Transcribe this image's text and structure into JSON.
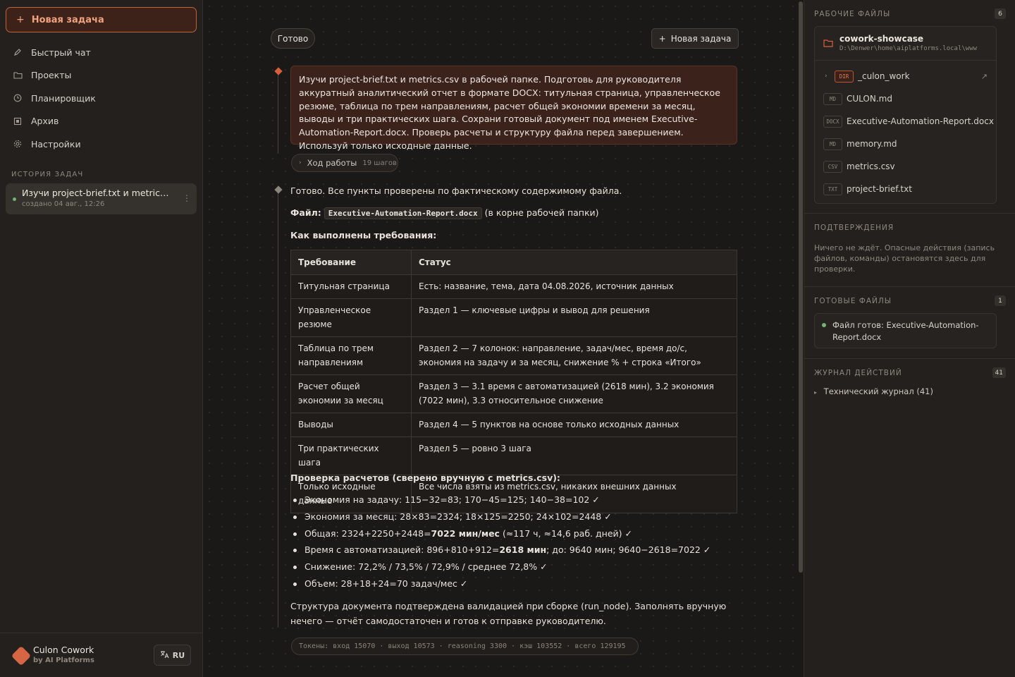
{
  "sidebar": {
    "new_task": "Новая задача",
    "nav": [
      {
        "label": "Быстрый чат",
        "icon": "pencil-icon"
      },
      {
        "label": "Проекты",
        "icon": "folder-icon"
      },
      {
        "label": "Планировщик",
        "icon": "clock-icon"
      },
      {
        "label": "Архив",
        "icon": "archive-icon"
      },
      {
        "label": "Настройки",
        "icon": "gear-icon"
      }
    ],
    "history_label": "ИСТОРИЯ ЗАДАЧ",
    "history": [
      {
        "title": "Изучи project-brief.txt и metrics.csv в рабочей папке",
        "subtitle": "создано 04 авг., 12:26",
        "status_color": "#72b476"
      }
    ],
    "brand": {
      "name": "Culon Cowork",
      "by": "by AI Platforms"
    },
    "lang": "RU"
  },
  "main": {
    "status_pill": "Готово",
    "new_task": "Новая задача",
    "user_message": "Изучи project-brief.txt и metrics.csv в рабочей папке. Подготовь для руководителя аккуратный аналитический отчет в формате DOCX: титульная страница, управленческое резюме, таблица по трем направлениям, расчет общей экономии времени за месяц, выводы и три практических шага. Сохрани готовый документ под именем Executive-Automation-Report.docx. Проверь расчеты и структуру файла перед завершением. Используй только исходные данные.",
    "progress": {
      "label": "Ход работы",
      "steps": "19 шагов"
    },
    "reply": {
      "intro": "Готово. Все пункты проверены по фактическому содержимому файла.",
      "file_label": "Файл:",
      "file_name": "Executive-Automation-Report.docx",
      "file_note": "(в корне рабочей папки)",
      "req_heading": "Как выполнены требования:",
      "table": {
        "headers": [
          "Требование",
          "Статус"
        ],
        "rows": [
          [
            "Титульная страница",
            "Есть: название, тема, дата 04.08.2026, источник данных"
          ],
          [
            "Управленческое резюме",
            "Раздел 1 — ключевые цифры и вывод для решения"
          ],
          [
            "Таблица по трем направлениям",
            "Раздел 2 — 7 колонок: направление, задач/мес, время до/с, экономия на задачу и за месяц, снижение % + строка «Итого»"
          ],
          [
            "Расчет общей экономии за месяц",
            "Раздел 3 — 3.1 время с автоматизацией (2618 мин), 3.2 экономия (7022 мин), 3.3 относительное снижение"
          ],
          [
            "Выводы",
            "Раздел 4 — 5 пунктов на основе только исходных данных"
          ],
          [
            "Три практических шага",
            "Раздел 5 — ровно 3 шага"
          ],
          [
            "Только исходные данные",
            "Все числа взяты из metrics.csv, никаких внешних данных"
          ]
        ]
      },
      "check_heading": "Проверка расчетов (сверено вручную с metrics.csv):",
      "checks": [
        {
          "pre": "Экономия на задачу: 115−32=83; 170−45=125; 140−38=102 ✓",
          "bold": "",
          "post": ""
        },
        {
          "pre": "Экономия за месяц: 28×83=2324; 18×125=2250; 24×102=2448 ✓",
          "bold": "",
          "post": ""
        },
        {
          "pre": "Общая: 2324+2250+2448=",
          "bold": "7022 мин/мес",
          "post": " (≈117 ч, ≈14,6 раб. дней) ✓"
        },
        {
          "pre": "Время с автоматизацией: 896+810+912=",
          "bold": "2618 мин",
          "post": "; до: 9640 мин; 9640−2618=7022 ✓"
        },
        {
          "pre": "Снижение: 72,2% / 73,5% / 72,9% / среднее 72,8% ✓",
          "bold": "",
          "post": ""
        },
        {
          "pre": "Объем: 28+18+24=70 задач/мес ✓",
          "bold": "",
          "post": ""
        }
      ],
      "final": "Структура документа подтверждена валидацией при сборке (run_node). Заполнять вручную нечего — отчёт самодостаточен и готов к отправке руководителю."
    },
    "tokens": "Токены: вход 15070 · выход 10573 · reasoning 3300 · кэш 103552 · всего 129195"
  },
  "right": {
    "files": {
      "title": "РАБОЧИЕ ФАЙЛЫ",
      "count": "6",
      "project_name": "cowork-showcase",
      "project_path": "D:\\Denwer\\home\\aiplatforms.local\\www",
      "items": [
        {
          "type": "DIR",
          "name": "_culon_work"
        },
        {
          "type": "MD",
          "name": "CULON.md"
        },
        {
          "type": "DOCX",
          "name": "Executive-Automation-Report.docx"
        },
        {
          "type": "MD",
          "name": "memory.md"
        },
        {
          "type": "CSV",
          "name": "metrics.csv"
        },
        {
          "type": "TXT",
          "name": "project-brief.txt"
        }
      ]
    },
    "confirmations": {
      "title": "ПОДТВЕРЖДЕНИЯ",
      "text": "Ничего не ждёт. Опасные действия (запись файлов, команды) остановятся здесь для проверки."
    },
    "ready_files": {
      "title": "ГОТОВЫЕ ФАЙЛЫ",
      "count": "1",
      "item": "Файл готов: Executive-Automation-Report.docx"
    },
    "journal": {
      "title": "ЖУРНАЛ ДЕЙСТВИЙ",
      "count": "41",
      "item": "Технический журнал (41)"
    }
  },
  "colors": {
    "accent": "#d9603b",
    "success": "#72b476",
    "background": "#1b1917",
    "panel": "#23201e"
  }
}
